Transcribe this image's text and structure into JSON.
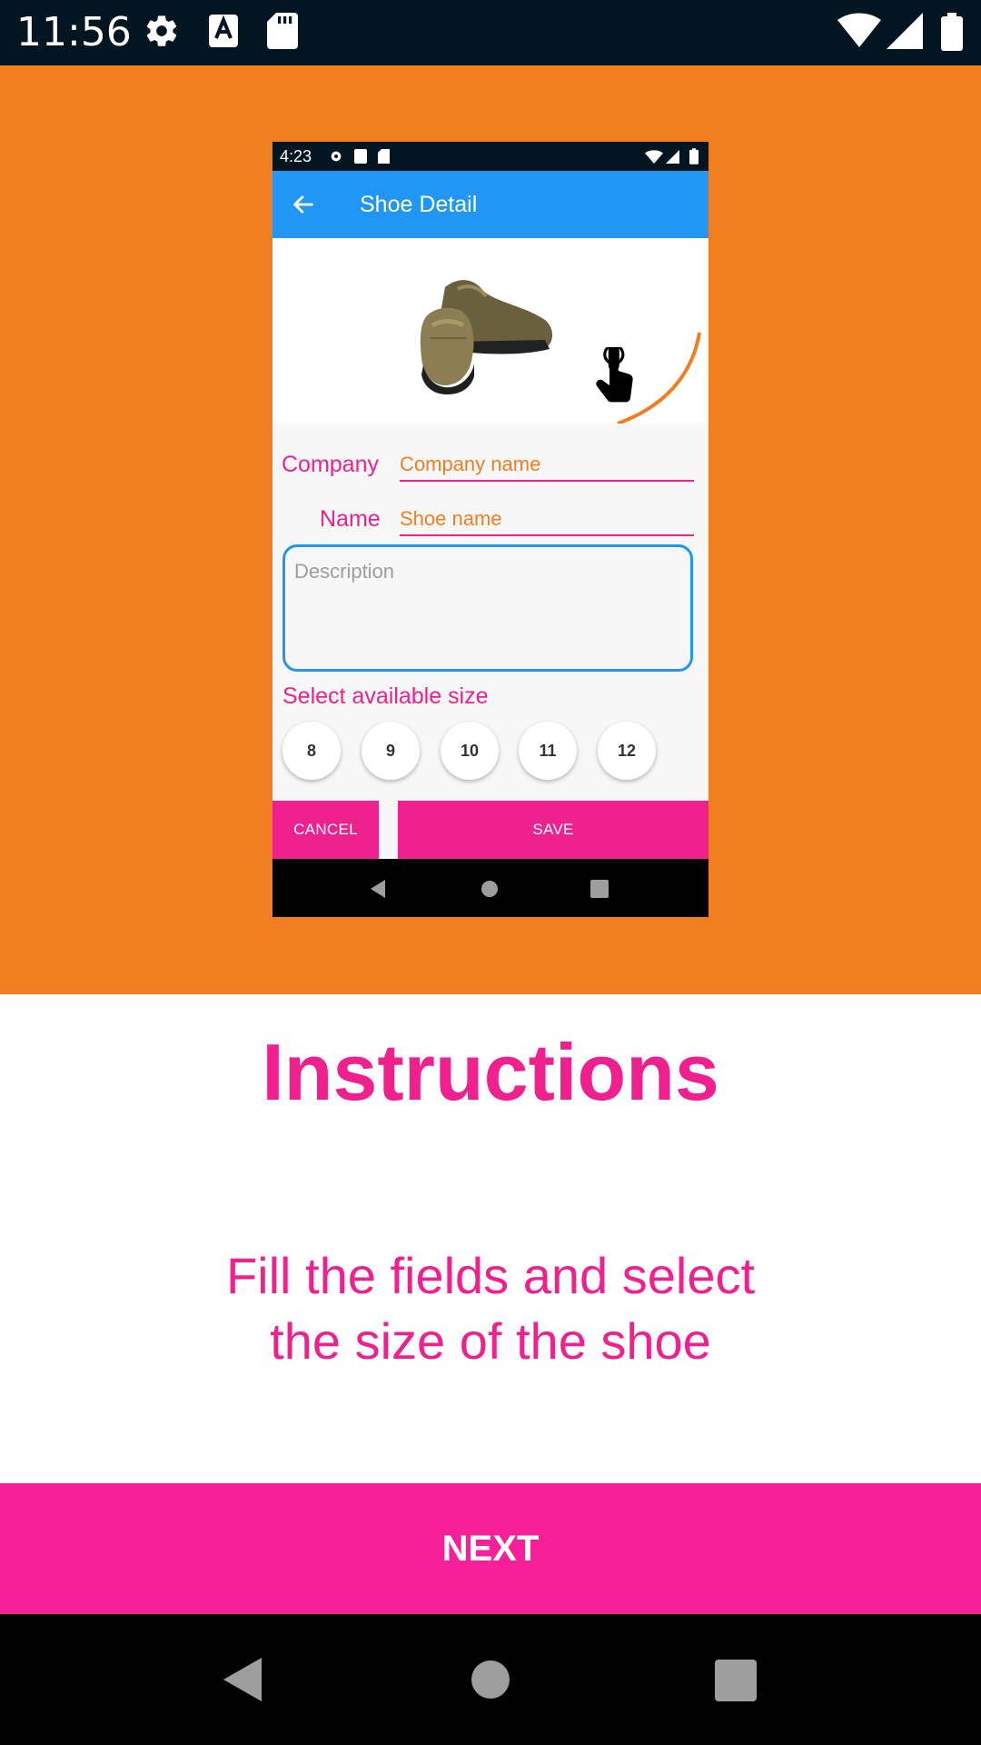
{
  "status_bar": {
    "time": "11:56",
    "icons": [
      "gear-icon",
      "a-notification-icon",
      "sd-card-icon",
      "wifi-icon",
      "cell-signal-icon",
      "battery-icon"
    ]
  },
  "mockup": {
    "status_time": "4:23",
    "appbar_title": "Shoe Detail",
    "company_label": "Company",
    "company_placeholder": "Company name",
    "name_label": "Name",
    "name_placeholder": "Shoe name",
    "description_placeholder": "Description",
    "size_label": "Select available size",
    "sizes": [
      "8",
      "9",
      "10",
      "11",
      "12"
    ],
    "cancel_label": "CANCEL",
    "save_label": "SAVE"
  },
  "instructions": {
    "heading": "Instructions",
    "line1": "Fill the fields and select",
    "line2": "the size of the shoe"
  },
  "next_label": "NEXT",
  "colors": {
    "orange": "#f27e22",
    "pink": "#f0208f",
    "blue": "#2196f3",
    "status_bar": "#031520"
  }
}
